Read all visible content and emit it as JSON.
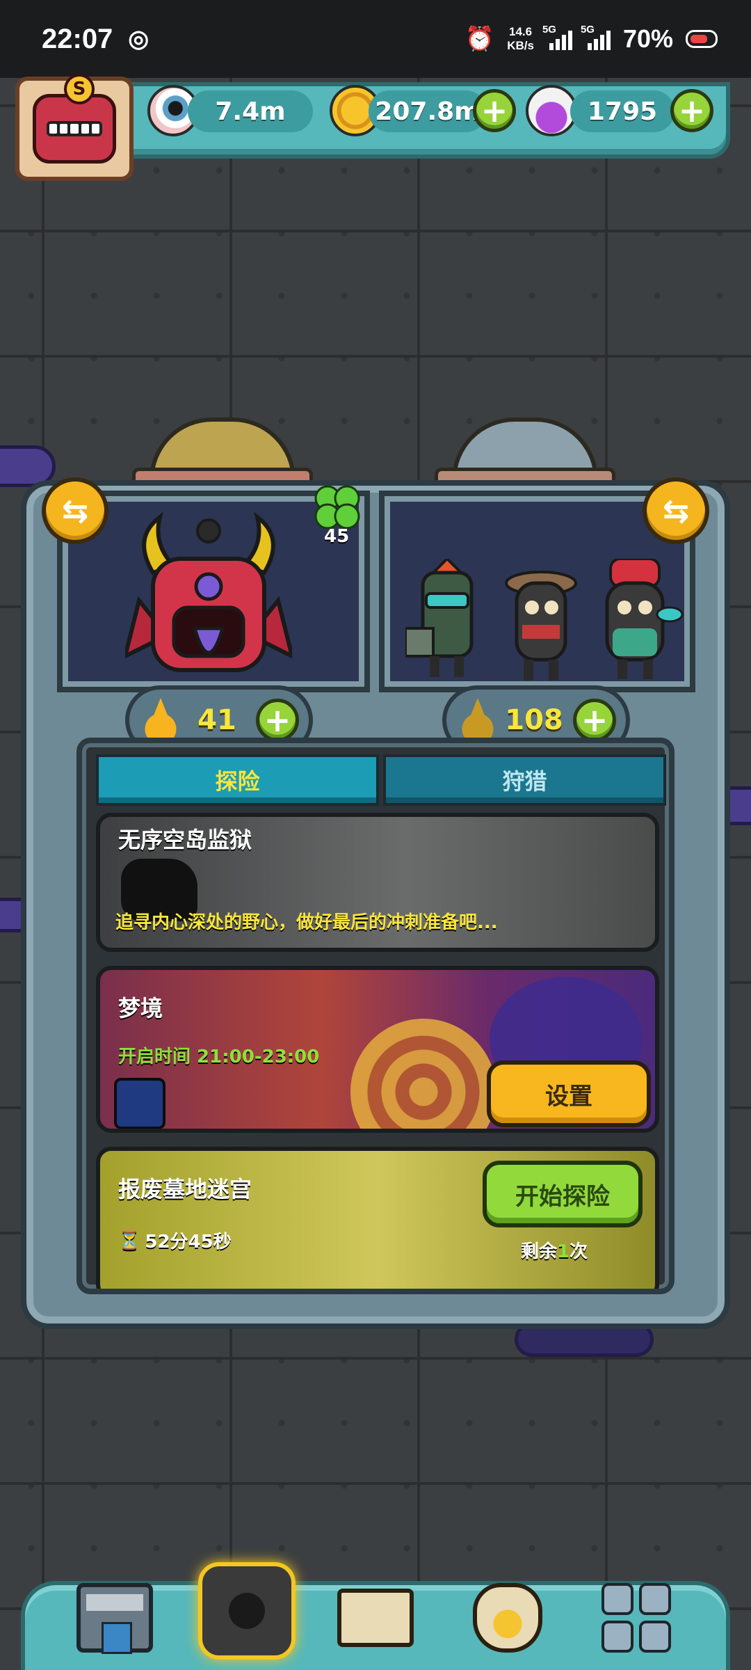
{
  "status_bar": {
    "time": "22:07",
    "net_speed_value": "14.6",
    "net_speed_unit": "KB/s",
    "sim1": "5G",
    "sim2": "5G",
    "battery": "70%"
  },
  "resources": {
    "eyes": "7.4m",
    "coins": "207.8m",
    "potions": "1795",
    "plus_label": "+"
  },
  "profile_badge": {
    "letter": "S"
  },
  "team": {
    "swap_label": "⇆",
    "clover_count": "45",
    "left_drops": "41",
    "right_drops": "108"
  },
  "tabs": [
    {
      "label": "探险",
      "active": true
    },
    {
      "label": "狩猎",
      "active": false
    }
  ],
  "cards": {
    "prison": {
      "title": "无序空岛监狱",
      "desc": "追寻内心深处的野心，做好最后的冲刺准备吧..."
    },
    "dream": {
      "title": "梦境",
      "time": "开启时间 21:00-23:00",
      "button": "设置"
    },
    "maze": {
      "title": "报废墓地迷宫",
      "timer_icon": "⏳",
      "timer": "52分45秒",
      "button": "开始探险",
      "remain_prefix": "剩余",
      "remain_count": "1",
      "remain_suffix": "次"
    }
  },
  "bottom_nav": [
    {
      "name": "shop",
      "icon": "shop-icon"
    },
    {
      "name": "home",
      "icon": "monster-home-icon"
    },
    {
      "name": "book",
      "icon": "book-icon"
    },
    {
      "name": "bag",
      "icon": "money-bag-icon"
    },
    {
      "name": "more",
      "icon": "grid-icon"
    }
  ]
}
